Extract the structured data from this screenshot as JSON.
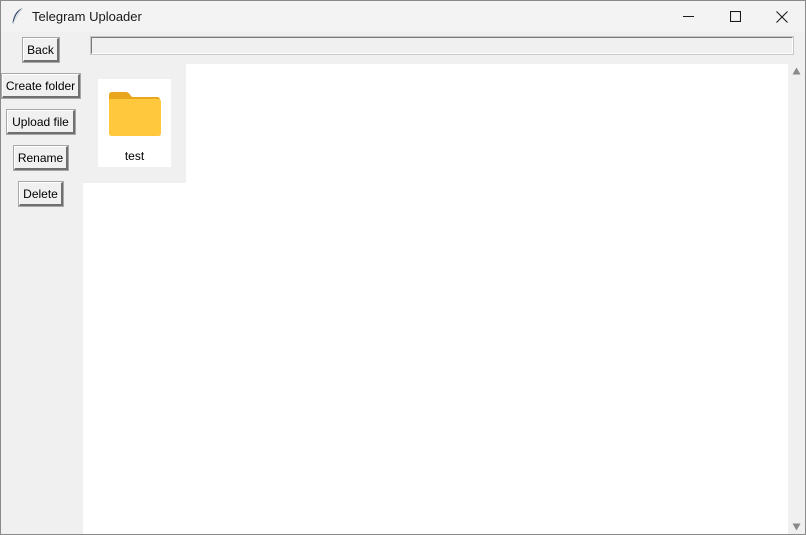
{
  "window": {
    "title": "Telegram Uploader",
    "controls": {
      "minimize_icon": "minimize-icon",
      "maximize_icon": "maximize-icon",
      "close_icon": "close-icon"
    },
    "app_icon": "feather-icon"
  },
  "toolbar": {
    "back_label": "Back",
    "path_value": ""
  },
  "sidebar": {
    "buttons": [
      {
        "label": "Create folder"
      },
      {
        "label": "Upload file"
      },
      {
        "label": "Rename"
      },
      {
        "label": "Delete"
      }
    ]
  },
  "files": {
    "items": [
      {
        "name": "test",
        "type": "folder",
        "icon": "folder-icon"
      }
    ]
  },
  "colors": {
    "folder": "#ffc83d",
    "folder_back": "#e9a61d",
    "window_bg": "#f0f0f0",
    "content_bg": "#ffffff"
  }
}
